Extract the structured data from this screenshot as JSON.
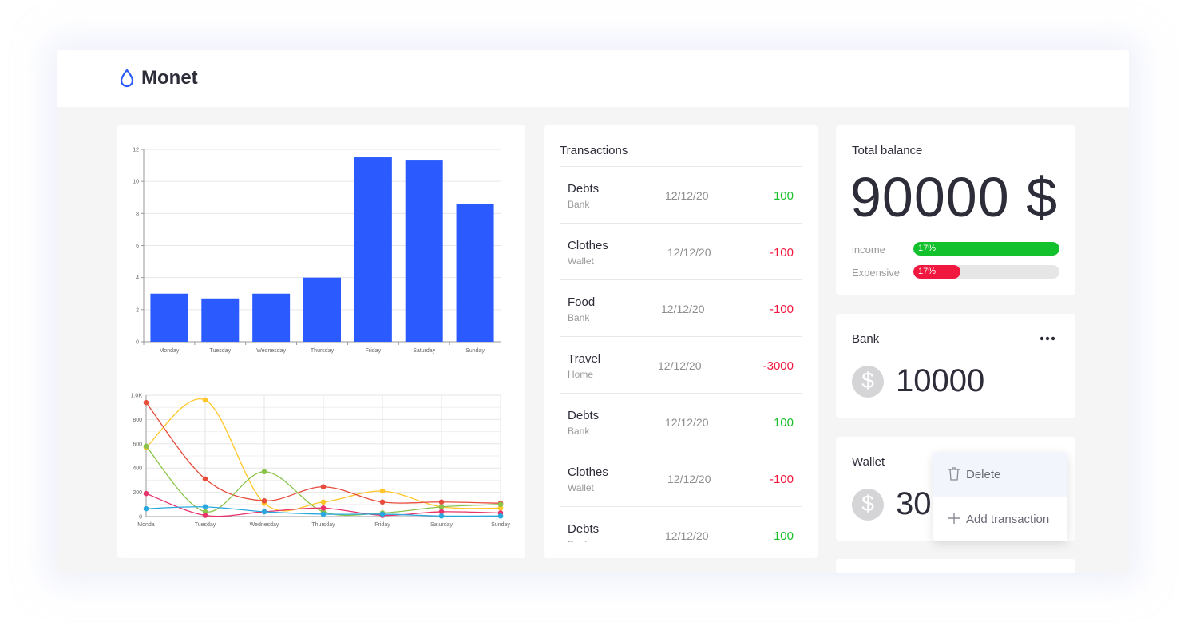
{
  "app": {
    "name": "Monet",
    "accent": "#2b5bff"
  },
  "colors": {
    "positive": "#1bbf2b",
    "negative": "#f0183e",
    "bar": "#2b5bff"
  },
  "chart_data": [
    {
      "type": "bar",
      "categories": [
        "Monday",
        "Tuesday",
        "Wednesday",
        "Thursday",
        "Friday",
        "Saturday",
        "Sunday"
      ],
      "values": [
        3,
        2.7,
        3,
        4,
        11.5,
        11.3,
        8.6
      ],
      "ylim": [
        0,
        12
      ],
      "yticks": [
        "0",
        "2",
        "4",
        "6",
        "8",
        "10",
        "12"
      ],
      "grid": true
    },
    {
      "type": "line",
      "categories": [
        "Monda",
        "Tuesday",
        "Wednesday",
        "Thursday",
        "Friday",
        "Saturday",
        "Sunday"
      ],
      "ylim": [
        0,
        1000
      ],
      "yticks": [
        "0",
        "200",
        "400",
        "600",
        "800",
        "1.0K"
      ],
      "grid": true,
      "series": [
        {
          "color": "#ffc629",
          "values": [
            570,
            960,
            110,
            120,
            210,
            80,
            70
          ]
        },
        {
          "color": "#e74c3c",
          "values": [
            940,
            310,
            130,
            245,
            120,
            120,
            110
          ]
        },
        {
          "color": "#8bc34a",
          "values": [
            580,
            40,
            370,
            40,
            30,
            80,
            100
          ]
        },
        {
          "color": "#e8336b",
          "values": [
            190,
            10,
            40,
            70,
            10,
            40,
            30
          ]
        },
        {
          "color": "#29a8e0",
          "values": [
            65,
            80,
            40,
            20,
            20,
            5,
            5
          ]
        }
      ]
    }
  ],
  "transactions": {
    "title": "Transactions",
    "items": [
      {
        "name": "Debts",
        "source": "Bank",
        "date": "12/12/20",
        "amount": "100",
        "sign": "pos"
      },
      {
        "name": "Clothes",
        "source": "Wallet",
        "date": "12/12/20",
        "amount": "-100",
        "sign": "neg"
      },
      {
        "name": "Food",
        "source": "Bank",
        "date": "12/12/20",
        "amount": "-100",
        "sign": "neg"
      },
      {
        "name": "Travel",
        "source": "Home",
        "date": "12/12/20",
        "amount": "-3000",
        "sign": "neg"
      },
      {
        "name": "Debts",
        "source": "Bank",
        "date": "12/12/20",
        "amount": "100",
        "sign": "pos"
      },
      {
        "name": "Clothes",
        "source": "Wallet",
        "date": "12/12/20",
        "amount": "-100",
        "sign": "neg"
      },
      {
        "name": "Debts",
        "source": "Bank",
        "date": "12/12/20",
        "amount": "100",
        "sign": "pos"
      }
    ]
  },
  "balance": {
    "title": "Total balance",
    "value": "90000 $",
    "income": {
      "label": "income",
      "percent_text": "17%",
      "fraction": 1.0,
      "color": "#12c12b"
    },
    "expensive": {
      "label": "Expensive",
      "percent_text": "17%",
      "fraction": 0.32,
      "color": "#f0183e"
    }
  },
  "bank": {
    "title": "Bank",
    "currency_symbol": "$",
    "value": "10000",
    "menu_icon": "more-horizontal-icon"
  },
  "wallet": {
    "title": "Wallet",
    "currency_symbol": "$",
    "value": "3000"
  },
  "dropdown": {
    "delete_label": "Delete",
    "delete_icon": "trash-icon",
    "add_label": "Add transaction",
    "add_icon": "plus-icon"
  }
}
